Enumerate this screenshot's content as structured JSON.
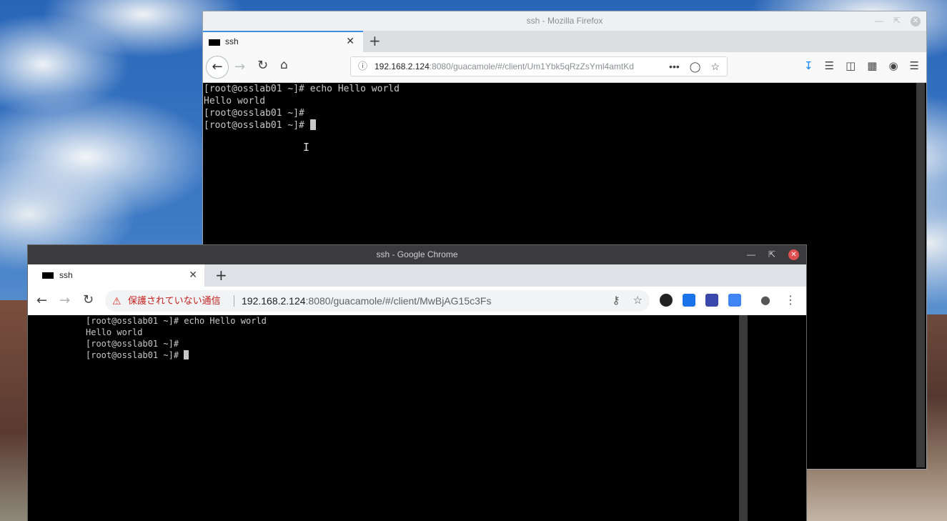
{
  "firefox": {
    "window_title": "ssh - Mozilla Firefox",
    "tab_label": "ssh",
    "url_host": "192.168.2.124",
    "url_rest": ":8080/guacamole/#/client/Um1Ybk5qRzZsYml4amtKd",
    "terminal_lines": [
      "[root@osslab01 ~]# echo Hello world",
      "Hello world",
      "[root@osslab01 ~]#",
      "[root@osslab01 ~]# "
    ]
  },
  "chrome": {
    "window_title": "ssh - Google Chrome",
    "tab_label": "ssh",
    "not_secure_label": "保護されていない通信",
    "url_host": "192.168.2.124",
    "url_rest": ":8080/guacamole/#/client/MwBjAG15c3Fs",
    "terminal_lines": [
      "[root@osslab01 ~]# echo Hello world",
      "Hello world",
      "[root@osslab01 ~]#",
      "[root@osslab01 ~]# "
    ]
  },
  "colors": {
    "chrome_close": "#e05050",
    "firefox_accent": "#3b8fe0",
    "warning_red": "#c5221f"
  }
}
